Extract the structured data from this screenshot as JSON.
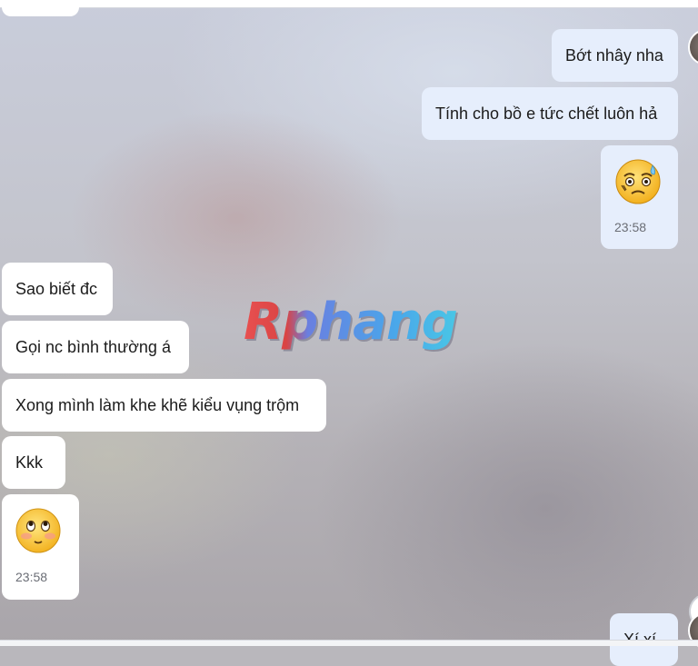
{
  "app": "chat",
  "watermark": "Rphang",
  "messages": {
    "out1": "Bớt nhây nha",
    "out2": "Tính cho bồ e tức chết luôn hả",
    "out_sticker_time": "23:58",
    "in1": "Sao biết đc",
    "in2": "Gọi nc bình thường á",
    "in3": "Xong mình làm khe khẽ kiểu vụng trộm",
    "in4": "Kkk",
    "in_sticker_time": "23:58",
    "out_partial": "Xí xí"
  },
  "stickers": {
    "out": "worried-sweat-face-emoji",
    "in": "pleading-blush-face-emoji"
  },
  "colors": {
    "incoming_bubble": "#ffffff",
    "outgoing_bubble": "#e6eefc",
    "watermark_red": "#e85050",
    "watermark_blue": "#4aa6ea"
  }
}
